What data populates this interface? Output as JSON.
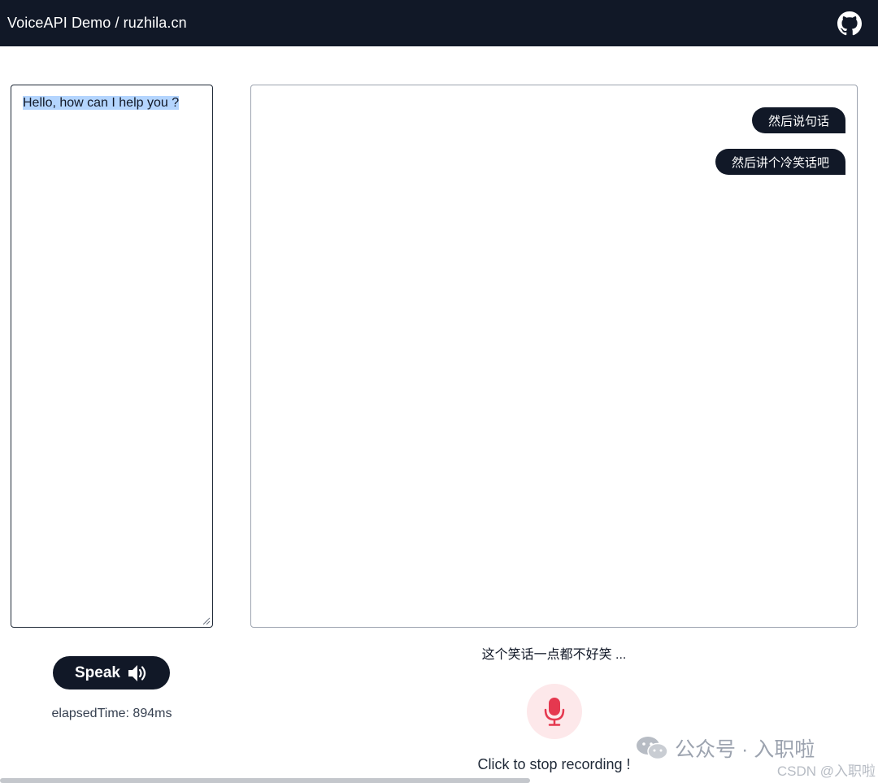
{
  "header": {
    "title": "VoiceAPI Demo / ruzhila.cn",
    "github_icon": "github-icon"
  },
  "text_input": {
    "value": "Hello, how can I help you ?"
  },
  "chat": {
    "messages": [
      {
        "text": "然后说句话"
      },
      {
        "text": "然后讲个冷笑话吧"
      }
    ]
  },
  "speak": {
    "label": "Speak",
    "icon": "speaker-icon",
    "elapsed": "elapsedTime: 894ms"
  },
  "recording": {
    "transcript": "这个笑话一点都不好笑 ...",
    "status": "Click to stop recording !",
    "icon": "microphone-icon",
    "accent": "#e5384f"
  },
  "watermark": {
    "text": "公众号 · 入职啦",
    "csdn": "CSDN @入职啦"
  },
  "colors": {
    "navbar": "#111827",
    "bubble": "#111827",
    "mic_bg": "#fde8ea",
    "selection": "#b4d5fe"
  }
}
